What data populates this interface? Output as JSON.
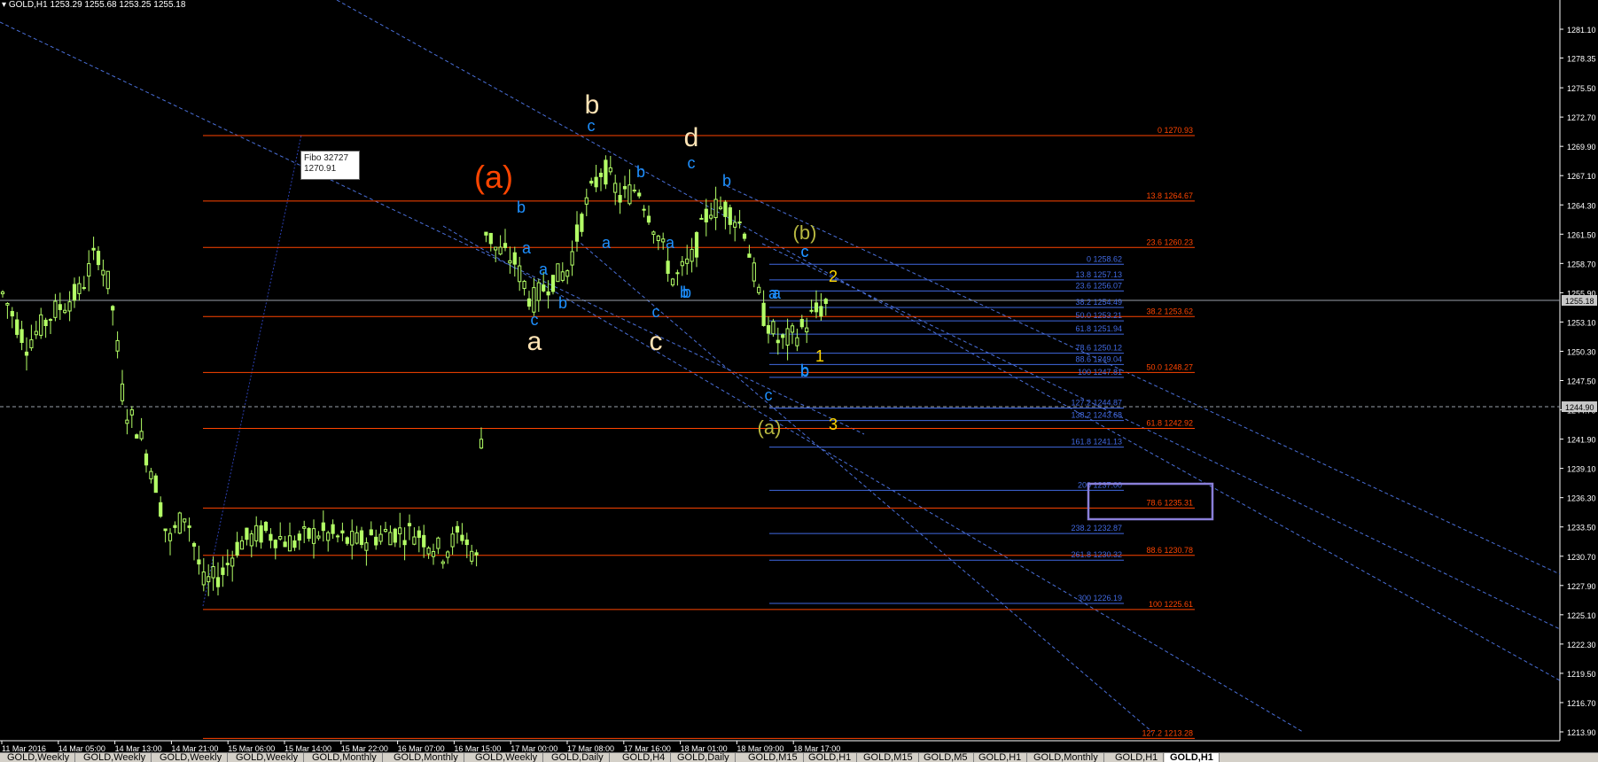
{
  "symbol_info": "GOLD,H1  1253.29 1255.68 1253.25 1255.18",
  "price_axis": [
    "1281.10",
    "1278.35",
    "1275.50",
    "1272.70",
    "1269.90",
    "1267.10",
    "1264.30",
    "1261.50",
    "1258.70",
    "1255.90",
    "1253.10",
    "1250.30",
    "1247.50",
    "1244.70",
    "1241.90",
    "1239.10",
    "1236.30",
    "1233.50",
    "1230.70",
    "1227.90",
    "1225.10",
    "1222.30",
    "1219.50",
    "1216.70",
    "1213.90"
  ],
  "current_price": "1255.18",
  "second_price": "1244.90",
  "time_axis": [
    "11 Mar 2016",
    "14 Mar 05:00",
    "14 Mar 13:00",
    "14 Mar 21:00",
    "15 Mar 06:00",
    "15 Mar 14:00",
    "15 Mar 22:00",
    "16 Mar 07:00",
    "16 Mar 15:00",
    "17 Mar 00:00",
    "17 Mar 08:00",
    "17 Mar 16:00",
    "18 Mar 01:00",
    "18 Mar 09:00",
    "18 Mar 17:00"
  ],
  "fibo_tooltip": {
    "line1": "Fibo 32727",
    "line2": "1270.91"
  },
  "fib_red": [
    {
      "label": "0 1270.93",
      "price": 1270.93
    },
    {
      "label": "13.8 1264.67",
      "price": 1264.67
    },
    {
      "label": "23.6 1260.23",
      "price": 1260.23
    },
    {
      "label": "38.2 1253.62",
      "price": 1253.62
    },
    {
      "label": "50.0 1248.27",
      "price": 1248.27
    },
    {
      "label": "61.8 1242.92",
      "price": 1242.92
    },
    {
      "label": "78.6 1235.31",
      "price": 1235.31
    },
    {
      "label": "88.6 1230.78",
      "price": 1230.78
    },
    {
      "label": "100 1225.61",
      "price": 1225.61
    },
    {
      "label": "127.2 1213.28",
      "price": 1213.28
    }
  ],
  "fib_blue": [
    {
      "label": "0 1258.62",
      "price": 1258.62
    },
    {
      "label": "13.8 1257.13",
      "price": 1257.13
    },
    {
      "label": "23.6 1256.07",
      "price": 1256.07
    },
    {
      "label": "38.2 1254.49",
      "price": 1254.49
    },
    {
      "label": "50.0 1253.21",
      "price": 1253.21
    },
    {
      "label": "61.8 1251.94",
      "price": 1251.94
    },
    {
      "label": "78.6 1250.12",
      "price": 1250.12
    },
    {
      "label": "88.6 1249.04",
      "price": 1249.04
    },
    {
      "label": "100 1247.81",
      "price": 1247.81
    },
    {
      "label": "127.2 1244.87",
      "price": 1244.87
    },
    {
      "label": "138.2 1243.68",
      "price": 1243.68
    },
    {
      "label": "161.8 1241.13",
      "price": 1241.13
    },
    {
      "label": "200 1237.00",
      "price": 1237.0
    },
    {
      "label": "238.2 1232.87",
      "price": 1232.87
    },
    {
      "label": "261.8 1230.32",
      "price": 1230.32
    },
    {
      "label": "300 1226.19",
      "price": 1226.19
    }
  ],
  "wave_labels": [
    {
      "text": "b",
      "color": "#ffe4b5",
      "size": 30,
      "anchor": "b_top"
    },
    {
      "text": "(a)",
      "color": "#ff4500",
      "size": 36,
      "anchor": "a_big"
    },
    {
      "text": "d",
      "color": "#ffe4b5",
      "size": 30,
      "anchor": "d_top"
    },
    {
      "text": "(b)",
      "color": "#b8b840",
      "size": 22,
      "anchor": "b_paren"
    },
    {
      "text": "a",
      "color": "#ffe4b5",
      "size": 30,
      "anchor": "a_low"
    },
    {
      "text": "c",
      "color": "#ffe4b5",
      "size": 30,
      "anchor": "c_low"
    },
    {
      "text": "(a)",
      "color": "#b8b840",
      "size": 22,
      "anchor": "a_paren"
    },
    {
      "text": "1",
      "color": "#ffd700",
      "size": 18,
      "anchor": "n1"
    },
    {
      "text": "2",
      "color": "#ffd700",
      "size": 18,
      "anchor": "n2"
    },
    {
      "text": "3",
      "color": "#ffd700",
      "size": 18,
      "anchor": "n3"
    }
  ],
  "sub_labels": [
    "c",
    "b",
    "c",
    "a",
    "a",
    "b",
    "b",
    "c",
    "b",
    "a",
    "a",
    "b",
    "c",
    "b",
    "a",
    "c",
    "b",
    "a",
    "b",
    "c",
    "c"
  ],
  "tabs": [
    "GOLD,Weekly",
    "GOLD,Weekly",
    "GOLD,Weekly",
    "GOLD,Weekly",
    "GOLD,Monthly",
    "GOLD,Monthly",
    "GOLD,Weekly",
    "GOLD,Daily",
    "GOLD,H4",
    "GOLD,Daily",
    "GOLD,M15",
    "GOLD,H1",
    "GOLD,M15",
    "GOLD,M5",
    "GOLD,H1",
    "GOLD,Monthly",
    "GOLD,H1",
    "GOLD,H1"
  ],
  "active_tab": "GOLD,H1",
  "colors": {
    "bg": "#000000",
    "candle": "#b3ff66",
    "fib_red": "#ff4500",
    "fib_blue": "#4169e1",
    "trend": "#4a6fd8",
    "axis": "#ffffff",
    "sub_label": "#1e90ff"
  }
}
